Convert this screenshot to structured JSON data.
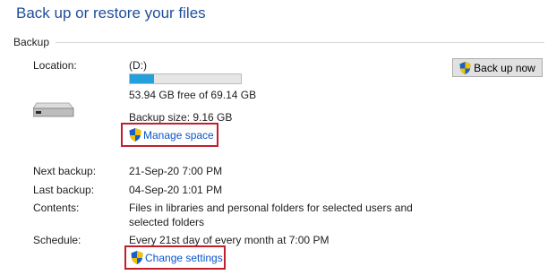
{
  "page": {
    "title": "Back up or restore your files"
  },
  "backup": {
    "section_label": "Backup",
    "location_label": "Location:",
    "location_value": "(D:)",
    "usage_fraction": 0.22,
    "free_text": "53.94 GB free of 69.14 GB",
    "backup_size_text": "Backup size: 9.16 GB",
    "manage_space_label": "Manage space",
    "back_up_now_label": "Back up now",
    "next_backup_label": "Next backup:",
    "next_backup_value": "21-Sep-20 7:00 PM",
    "last_backup_label": "Last backup:",
    "last_backup_value": "04-Sep-20 1:01 PM",
    "contents_label": "Contents:",
    "contents_value": "Files in libraries and personal folders for selected users and selected folders",
    "schedule_label": "Schedule:",
    "schedule_value": "Every 21st day of every month at 7:00 PM",
    "change_settings_label": "Change settings"
  },
  "colors": {
    "title": "#1f4e9a",
    "link": "#0a56c9",
    "highlight_box": "#c0202c",
    "progress": "#26a0da"
  },
  "icons": [
    "drive-icon",
    "uac-shield-icon"
  ]
}
